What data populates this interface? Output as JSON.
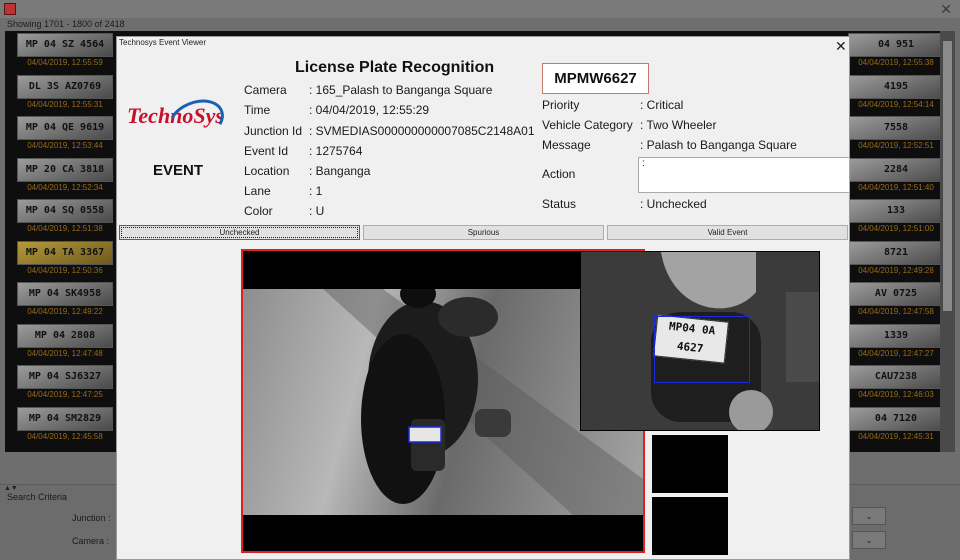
{
  "background_window": {
    "showing": "Showing 1701 - 1800 of 2418",
    "close_glyph": "✕",
    "left_tiles": [
      {
        "plate": "MP 04 SZ 4564",
        "time": "04/04/2019, 12:55:59"
      },
      {
        "plate": "DL 3S AZ0769",
        "time": "04/04/2019, 12:55:31"
      },
      {
        "plate": "MP 04 QE 9619",
        "time": "04/04/2019, 12:53:44"
      },
      {
        "plate": "MP 20 CA 3818",
        "time": "04/04/2019, 12:52:34"
      },
      {
        "plate": "MP 04 SQ 0558",
        "time": "04/04/2019, 12:51:38"
      },
      {
        "plate": "MP 04 TA 3367",
        "time": "04/04/2019, 12:50:36"
      },
      {
        "plate": "MP 04 SK4958",
        "time": "04/04/2019, 12:49:22"
      },
      {
        "plate": "MP 04 2808",
        "time": "04/04/2019, 12:47:48"
      },
      {
        "plate": "MP 04 SJ6327",
        "time": "04/04/2019, 12:47:25"
      },
      {
        "plate": "MP 04 SM2829",
        "time": "04/04/2019, 12:45:58"
      }
    ],
    "right_tiles": [
      {
        "plate": "04 951",
        "time": "04/04/2019, 12:55:38"
      },
      {
        "plate": "4195",
        "time": "04/04/2019, 12:54:14"
      },
      {
        "plate": "7558",
        "time": "04/04/2019, 12:52:51"
      },
      {
        "plate": "2284",
        "time": "04/04/2019, 12:51:40"
      },
      {
        "plate": "133",
        "time": "04/04/2019, 12:51:00"
      },
      {
        "plate": "8721",
        "time": "04/04/2019, 12:49:28"
      },
      {
        "plate": "AV 0725",
        "time": "04/04/2019, 12:47:58"
      },
      {
        "plate": "1339",
        "time": "04/04/2019, 12:47:27"
      },
      {
        "plate": "CAU7238",
        "time": "04/04/2019, 12:46:03"
      },
      {
        "plate": "04 7120",
        "time": "04/04/2019, 12:45:31"
      }
    ],
    "search_criteria": "Search Criteria",
    "junction_label": "Junction :",
    "camera_label": "Camera :",
    "chevron": "⌄"
  },
  "dialog": {
    "title": "Technosys Event Viewer",
    "close": "✕",
    "logo": "TechnoSys",
    "event_word": "EVENT",
    "heading": "License Plate Recognition",
    "fields": {
      "camera_label": "Camera",
      "camera_value": ": 165_Palash to Banganga Square",
      "time_label": "Time",
      "time_value": ": 04/04/2019, 12:55:29",
      "junction_label": "Junction Id",
      "junction_value": ": SVMEDIAS000000000007085C2148A01",
      "eventid_label": "Event Id",
      "eventid_value": ": 1275764",
      "location_label": "Location",
      "location_value": ": Banganga",
      "lane_label": "Lane",
      "lane_value": ": 1",
      "color_label": "Color",
      "color_value": ": U"
    },
    "plate_number": "MPMW6627",
    "right_fields": {
      "priority_label": "Priority",
      "priority_value": ": Critical",
      "category_label": "Vehicle Category",
      "category_value": ": Two Wheeler",
      "message_label": "Message",
      "message_value": ": Palash to Banganga Square",
      "action_label": "Action",
      "action_value": ":",
      "status_label": "Status",
      "status_value": ": Unchecked"
    },
    "buttons": {
      "unchecked": "Unchecked",
      "spurious": "Spurious",
      "valid": "Valid Event"
    },
    "zoom_plate_line1": "MP04 0A",
    "zoom_plate_line2": "4627"
  }
}
